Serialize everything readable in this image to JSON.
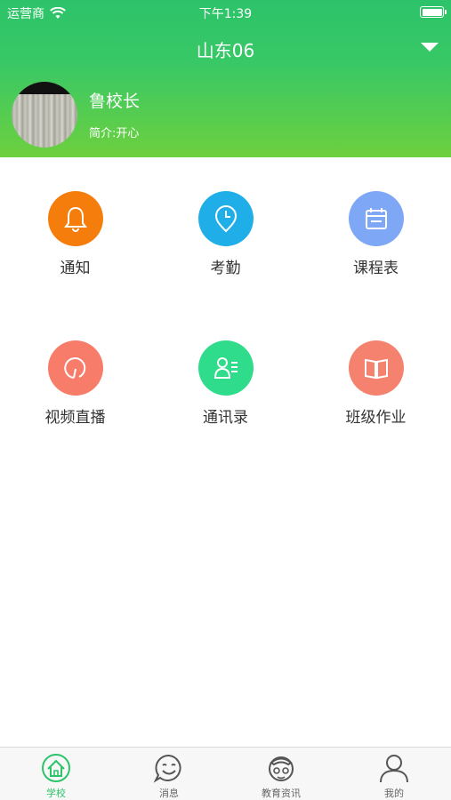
{
  "status_bar": {
    "carrier": "运营商",
    "time": "下午1:39"
  },
  "header": {
    "title": "山东06"
  },
  "profile": {
    "name": "鲁校长",
    "bio": "简介:开心"
  },
  "grid": [
    {
      "label": "通知",
      "icon": "bell-icon",
      "color": "#f57d0b"
    },
    {
      "label": "考勤",
      "icon": "clock-pin-icon",
      "color": "#20aee8"
    },
    {
      "label": "课程表",
      "icon": "calendar-icon",
      "color": "#7ea7f5"
    },
    {
      "label": "视频直播",
      "icon": "video-live-icon",
      "color": "#f77c6a"
    },
    {
      "label": "通讯录",
      "icon": "contacts-icon",
      "color": "#2fdc8b"
    },
    {
      "label": "班级作业",
      "icon": "book-icon",
      "color": "#f5826f"
    }
  ],
  "tabs": [
    {
      "label": "学校",
      "icon": "home-icon",
      "active": true
    },
    {
      "label": "消息",
      "icon": "smile-chat-icon",
      "active": false
    },
    {
      "label": "教育资讯",
      "icon": "news-icon",
      "active": false
    },
    {
      "label": "我的",
      "icon": "user-icon",
      "active": false
    }
  ],
  "colors": {
    "primary_green": "#2dc36a",
    "header_gradient_end": "#6dd03e"
  }
}
